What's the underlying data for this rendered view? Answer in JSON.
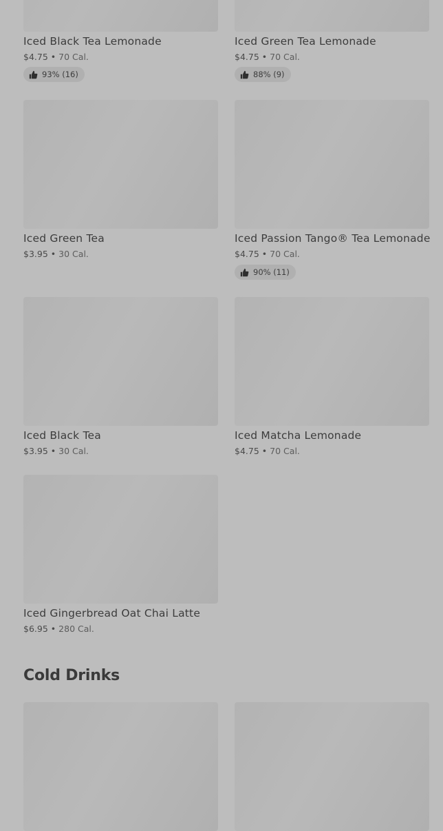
{
  "products": [
    {
      "name": "Iced Black Tea Lemonade",
      "price": "$4.75",
      "calories": "70 Cal.",
      "rating": "93% (16)"
    },
    {
      "name": "Iced Green Tea Lemonade",
      "price": "$4.75",
      "calories": "70 Cal.",
      "rating": "88% (9)"
    },
    {
      "name": "Iced Green Tea",
      "price": "$3.95",
      "calories": "30 Cal."
    },
    {
      "name": "Iced Passion Tango® Tea Lemonade",
      "price": "$4.75",
      "calories": "70 Cal.",
      "rating": "90% (11)"
    },
    {
      "name": "Iced Black Tea",
      "price": "$3.95",
      "calories": "30 Cal."
    },
    {
      "name": "Iced Matcha Lemonade",
      "price": "$4.75",
      "calories": "70 Cal."
    },
    {
      "name": "Iced Gingerbread Oat Chai Latte",
      "price": "$6.95",
      "calories": "280 Cal."
    }
  ],
  "sections": {
    "cold_drinks": "Cold Drinks"
  },
  "separator": "•",
  "icons": {
    "rating": "thumbs-up-icon"
  }
}
